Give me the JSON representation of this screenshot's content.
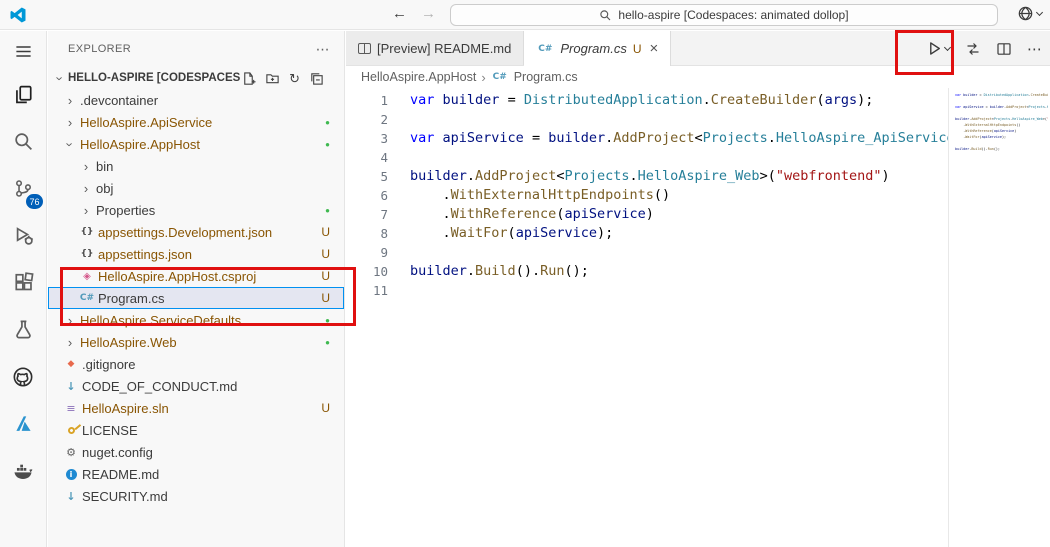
{
  "titlebar": {
    "search_label": "hello-aspire [Codespaces: animated dollop]"
  },
  "glyphs": {
    "back": "←",
    "forward": "→",
    "more": "⋯",
    "chevron_right": "›",
    "close": "×",
    "dot": "●",
    "refresh": "↻"
  },
  "icons": {
    "json": "{}",
    "cs": "C#",
    "csproj": "◈",
    "git": "◆",
    "md": "↓",
    "sln": "≡",
    "gear": "⚙",
    "info": "i"
  },
  "activity_bar": {
    "source_control_badge": "76",
    "items": [
      "menu",
      "explorer",
      "search",
      "source-control",
      "run-and-debug",
      "extensions",
      "testing",
      "github",
      "azure",
      "docker"
    ]
  },
  "sidebar": {
    "header": "EXPLORER",
    "root_label": "HELLO-ASPIRE [CODESPACES: A...",
    "tree": [
      {
        "label": ".devcontainer",
        "level": 1,
        "kind": "folder"
      },
      {
        "label": "HelloAspire.ApiService",
        "level": 1,
        "kind": "folder",
        "dot": true,
        "mod": true
      },
      {
        "label": "HelloAspire.AppHost",
        "level": 1,
        "kind": "folder",
        "expanded": true,
        "dot": true,
        "mod": true
      },
      {
        "label": "bin",
        "level": 2,
        "kind": "folder"
      },
      {
        "label": "obj",
        "level": 2,
        "kind": "folder"
      },
      {
        "label": "Properties",
        "level": 2,
        "kind": "folder",
        "dot": true
      },
      {
        "label": "appsettings.Development.json",
        "level": 2,
        "kind": "file",
        "icon": "json",
        "badge": "U",
        "mod": true
      },
      {
        "label": "appsettings.json",
        "level": 2,
        "kind": "file",
        "icon": "json",
        "badge": "U",
        "mod": true
      },
      {
        "label": "HelloAspire.AppHost.csproj",
        "level": 2,
        "kind": "file",
        "icon": "csproj",
        "badge": "U",
        "mod": true
      },
      {
        "label": "Program.cs",
        "level": 2,
        "kind": "file",
        "icon": "cs",
        "badge": "U",
        "selected": true
      },
      {
        "label": "HelloAspire.ServiceDefaults",
        "level": 1,
        "kind": "folder",
        "dot": true,
        "mod": true
      },
      {
        "label": "HelloAspire.Web",
        "level": 1,
        "kind": "folder",
        "dot": true,
        "mod": true
      },
      {
        "label": ".gitignore",
        "level": 1,
        "kind": "file",
        "icon": "git"
      },
      {
        "label": "CODE_OF_CONDUCT.md",
        "level": 1,
        "kind": "file",
        "icon": "md"
      },
      {
        "label": "HelloAspire.sln",
        "level": 1,
        "kind": "file",
        "icon": "sln",
        "badge": "U",
        "mod": true
      },
      {
        "label": "LICENSE",
        "level": 1,
        "kind": "file",
        "icon": "key"
      },
      {
        "label": "nuget.config",
        "level": 1,
        "kind": "file",
        "icon": "gear"
      },
      {
        "label": "README.md",
        "level": 1,
        "kind": "file",
        "icon": "info"
      },
      {
        "label": "SECURITY.md",
        "level": 1,
        "kind": "file",
        "icon": "md"
      }
    ]
  },
  "editor": {
    "tabs": [
      {
        "label": "[Preview] README.md"
      },
      {
        "label": "Program.cs",
        "modified": "U"
      }
    ],
    "breadcrumb": [
      {
        "label": "HelloAspire.AppHost"
      },
      {
        "label": "Program.cs"
      }
    ],
    "code": {
      "lines": [
        {
          "n": 1,
          "tokens": [
            {
              "t": "var",
              "c": "kw"
            },
            {
              "t": " ",
              "c": "pl"
            },
            {
              "t": "builder",
              "c": "vr"
            },
            {
              "t": " = ",
              "c": "pl"
            },
            {
              "t": "DistributedApplication",
              "c": "ty"
            },
            {
              "t": ".",
              "c": "pl"
            },
            {
              "t": "CreateBuilder",
              "c": "fn"
            },
            {
              "t": "(",
              "c": "pl"
            },
            {
              "t": "args",
              "c": "vr"
            },
            {
              "t": ");",
              "c": "pl"
            }
          ]
        },
        {
          "n": 2,
          "tokens": []
        },
        {
          "n": 3,
          "tokens": [
            {
              "t": "var",
              "c": "kw"
            },
            {
              "t": " ",
              "c": "pl"
            },
            {
              "t": "apiService",
              "c": "vr"
            },
            {
              "t": " = ",
              "c": "pl"
            },
            {
              "t": "builder",
              "c": "vr"
            },
            {
              "t": ".",
              "c": "pl"
            },
            {
              "t": "AddProject",
              "c": "fn"
            },
            {
              "t": "<",
              "c": "pl"
            },
            {
              "t": "Projects",
              "c": "ty"
            },
            {
              "t": ".",
              "c": "pl"
            },
            {
              "t": "HelloAspire_ApiService",
              "c": "ty"
            },
            {
              "t": ">(",
              "c": "pl"
            },
            {
              "t": "\"",
              "c": "st"
            }
          ]
        },
        {
          "n": 4,
          "tokens": []
        },
        {
          "n": 5,
          "tokens": [
            {
              "t": "builder",
              "c": "vr"
            },
            {
              "t": ".",
              "c": "pl"
            },
            {
              "t": "AddProject",
              "c": "fn"
            },
            {
              "t": "<",
              "c": "pl"
            },
            {
              "t": "Projects",
              "c": "ty"
            },
            {
              "t": ".",
              "c": "pl"
            },
            {
              "t": "HelloAspire_Web",
              "c": "ty"
            },
            {
              "t": ">(",
              "c": "pl"
            },
            {
              "t": "\"webfrontend\"",
              "c": "st"
            },
            {
              "t": ")",
              "c": "pl"
            }
          ]
        },
        {
          "n": 6,
          "tokens": [
            {
              "t": "    .",
              "c": "pl"
            },
            {
              "t": "WithExternalHttpEndpoints",
              "c": "fn"
            },
            {
              "t": "()",
              "c": "pl"
            }
          ]
        },
        {
          "n": 7,
          "tokens": [
            {
              "t": "    .",
              "c": "pl"
            },
            {
              "t": "WithReference",
              "c": "fn"
            },
            {
              "t": "(",
              "c": "pl"
            },
            {
              "t": "apiService",
              "c": "vr"
            },
            {
              "t": ")",
              "c": "pl"
            }
          ]
        },
        {
          "n": 8,
          "tokens": [
            {
              "t": "    .",
              "c": "pl"
            },
            {
              "t": "WaitFor",
              "c": "fn"
            },
            {
              "t": "(",
              "c": "pl"
            },
            {
              "t": "apiService",
              "c": "vr"
            },
            {
              "t": ");",
              "c": "pl"
            }
          ]
        },
        {
          "n": 9,
          "tokens": []
        },
        {
          "n": 10,
          "tokens": [
            {
              "t": "builder",
              "c": "vr"
            },
            {
              "t": ".",
              "c": "pl"
            },
            {
              "t": "Build",
              "c": "fn"
            },
            {
              "t": "().",
              "c": "pl"
            },
            {
              "t": "Run",
              "c": "fn"
            },
            {
              "t": "();",
              "c": "pl"
            }
          ]
        },
        {
          "n": 11,
          "tokens": []
        }
      ]
    }
  },
  "colors": {
    "modified_text": "#895503",
    "untracked_dot": "#3fb950",
    "badge_background": "#005fb8",
    "selection_outline": "#0090f1",
    "annotation_red": "#e01010",
    "accent_blue": "#0078d4"
  }
}
